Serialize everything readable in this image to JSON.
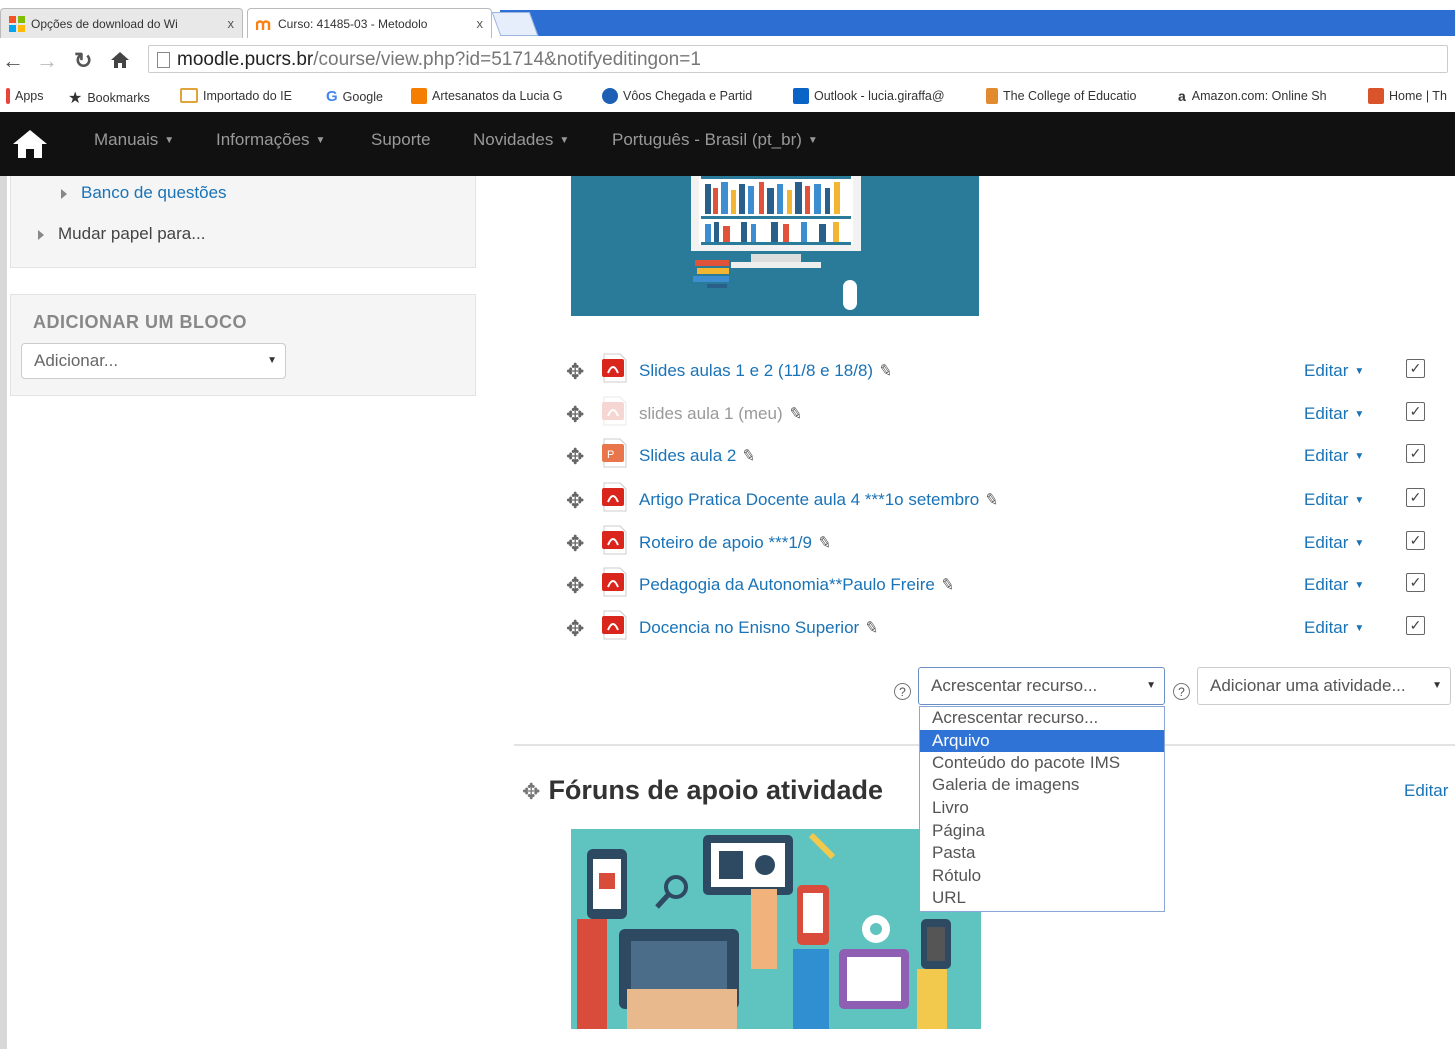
{
  "browser": {
    "tabs": [
      {
        "title": "Opções de download do Wi",
        "active": false
      },
      {
        "title": "Curso: 41485-03 - Metodolo",
        "active": true
      }
    ],
    "close_glyph": "x",
    "url_host": "moodle.pucrs.br",
    "url_path": "/course/view.php?id=51714&notifyeditingon=1",
    "bookmarks": [
      {
        "label": "Apps",
        "icon": "apps-grid-icon",
        "color": "#e8453c"
      },
      {
        "label": "Bookmarks",
        "icon": "star-icon",
        "color": "#333333"
      },
      {
        "label": "Importado do IE",
        "icon": "folder-icon",
        "color": "#e0a43a"
      },
      {
        "label": "Google",
        "icon": "google-g-icon",
        "color": "#4285f4"
      },
      {
        "label": "Artesanatos da Lucia G",
        "icon": "blogger-icon",
        "color": "#f57d00"
      },
      {
        "label": "Vôos Chegada e Partid",
        "icon": "plane-icon",
        "color": "#1c5fb4"
      },
      {
        "label": "Outlook - lucia.giraffa@",
        "icon": "outlook-icon",
        "color": "#0a64c8"
      },
      {
        "label": "The College of Educatio",
        "icon": "college-icon",
        "color": "#e28a2f"
      },
      {
        "label": "Amazon.com: Online Sh",
        "icon": "amazon-icon",
        "color": "#222222"
      },
      {
        "label": "Home | Th",
        "icon": "home-th-icon",
        "color": "#d9532b"
      }
    ]
  },
  "navbar": {
    "items": [
      {
        "label": "Manuais",
        "dropdown": true
      },
      {
        "label": "Informações",
        "dropdown": true
      },
      {
        "label": "Suporte",
        "dropdown": false
      },
      {
        "label": "Novidades",
        "dropdown": true
      },
      {
        "label": "Português - Brasil (pt_br)",
        "dropdown": true
      }
    ]
  },
  "left": {
    "tree": [
      {
        "label": "Banco de questões",
        "link": true
      },
      {
        "label": "Mudar papel para...",
        "link": false
      }
    ],
    "add_block": {
      "title": "ADICIONAR UM BLOCO",
      "select_value": "Adicionar..."
    }
  },
  "resources": [
    {
      "name": "Slides aulas 1 e 2 (11/8 e 18/8)",
      "hidden": false
    },
    {
      "name": "slides aula 1 (meu)",
      "hidden": true
    },
    {
      "name": "Slides aula 2",
      "hidden": false
    },
    {
      "name": "Artigo Pratica Docente aula 4 ***1o setembro",
      "hidden": false
    },
    {
      "name": "Roteiro de apoio ***1/9",
      "hidden": false
    },
    {
      "name": "Pedagogia da Autonomia**Paulo Freire",
      "hidden": false
    },
    {
      "name": "Docencia no Enisno Superior",
      "hidden": false
    }
  ],
  "row_edit_label": "Editar",
  "add_resource": {
    "select_value": "Acrescentar recurso...",
    "options": [
      "Acrescentar recurso...",
      "Arquivo",
      "Conteúdo do pacote IMS",
      "Galeria de imagens",
      "Livro",
      "Página",
      "Pasta",
      "Rótulo",
      "URL"
    ],
    "selected_index": 1
  },
  "add_activity": {
    "select_value": "Adicionar uma atividade..."
  },
  "next_section": {
    "title": "Fóruns de apoio atividade",
    "edit_label": "Editar"
  },
  "colors": {
    "link": "#1a73b6",
    "navbar": "#111111",
    "selected_option": "#2f73d6"
  }
}
